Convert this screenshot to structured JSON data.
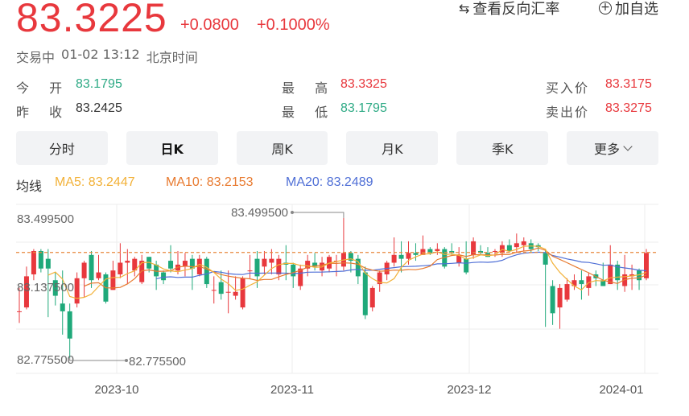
{
  "quote": {
    "price": "83.3225",
    "change": "+0.0800",
    "change_pct": "+0.1000%",
    "status": "交易中",
    "datetime": "01-02 13:12",
    "timezone": "北京时间"
  },
  "actions": {
    "reverse_label": "查看反向汇率",
    "watchlist_label": "加自选"
  },
  "stats": {
    "open_label": "今 开",
    "open": "83.1795",
    "high_label": "最 高",
    "high": "83.3325",
    "bid_label": "买入价",
    "bid": "83.3175",
    "prev_label": "昨 收",
    "prev": "83.2425",
    "low_label": "最 低",
    "low": "83.1795",
    "ask_label": "卖出价",
    "ask": "83.3275"
  },
  "tabs": [
    "分时",
    "日K",
    "周K",
    "月K",
    "季K",
    "更多"
  ],
  "active_tab": "日K",
  "ma": {
    "label": "均线",
    "ma5": "MA5: 83.2447",
    "ma10": "MA10: 83.2153",
    "ma20": "MA20: 83.2489"
  },
  "colors": {
    "up": "#e8383d",
    "down": "#1fa97a",
    "ma5": "#f2b138",
    "ma10": "#e87a2f",
    "ma20": "#4f6fd6"
  },
  "chart_data": {
    "type": "candlestick",
    "y_tick_labels": [
      "83.499500",
      "83.137500",
      "82.775500"
    ],
    "ylim": [
      82.7755,
      83.4995
    ],
    "x_tick_labels": [
      "2023-10",
      "2023-11",
      "2023-12",
      "2024-01"
    ],
    "max_annotation": "83.499500",
    "min_annotation": "82.775500",
    "current_price": 83.3225,
    "candles": [
      [
        83.02,
        83.02,
        83.14,
        82.96
      ],
      [
        83.04,
        83.2,
        83.25,
        83.03
      ],
      [
        83.21,
        83.33,
        83.34,
        83.18
      ],
      [
        83.33,
        83.24,
        83.34,
        83.22
      ],
      [
        83.29,
        83.24,
        83.34,
        82.99
      ],
      [
        83.18,
        83.1,
        83.22,
        83.05
      ],
      [
        83.06,
        83.02,
        83.23,
        82.9
      ],
      [
        83.02,
        82.88,
        83.06,
        82.78
      ],
      [
        83.06,
        83.19,
        83.22,
        83.04
      ],
      [
        83.19,
        83.27,
        83.28,
        83.09
      ],
      [
        83.31,
        83.18,
        83.33,
        83.14
      ],
      [
        83.19,
        83.22,
        83.31,
        83.18
      ],
      [
        83.21,
        83.07,
        83.22,
        83.06
      ],
      [
        83.13,
        83.23,
        83.28,
        83.13
      ],
      [
        83.21,
        83.27,
        83.37,
        83.19
      ],
      [
        83.27,
        83.28,
        83.34,
        83.16
      ],
      [
        83.23,
        83.29,
        83.3,
        83.2
      ],
      [
        83.17,
        83.28,
        83.31,
        83.16
      ],
      [
        83.3,
        83.24,
        83.3,
        83.22
      ],
      [
        83.26,
        83.2,
        83.28,
        83.13
      ],
      [
        83.22,
        83.18,
        83.23,
        83.16
      ],
      [
        83.28,
        83.24,
        83.36,
        83.22
      ],
      [
        83.23,
        83.26,
        83.33,
        83.21
      ],
      [
        83.25,
        83.28,
        83.32,
        83.2
      ],
      [
        83.29,
        83.24,
        83.31,
        83.13
      ],
      [
        83.21,
        83.29,
        83.31,
        83.2
      ],
      [
        83.29,
        83.16,
        83.3,
        83.14
      ],
      [
        83.13,
        83.13,
        83.2,
        83.06
      ],
      [
        83.17,
        83.11,
        83.23,
        83.08
      ],
      [
        83.12,
        83.12,
        83.23,
        83.01
      ],
      [
        83.1,
        83.12,
        83.2,
        83.08
      ],
      [
        83.04,
        83.19,
        83.2,
        83.03
      ],
      [
        83.23,
        83.23,
        83.31,
        83.19
      ],
      [
        83.29,
        83.2,
        83.33,
        83.14
      ],
      [
        83.25,
        83.29,
        83.33,
        83.21
      ],
      [
        83.27,
        83.29,
        83.34,
        83.21
      ],
      [
        83.21,
        83.29,
        83.31,
        83.18
      ],
      [
        83.27,
        83.26,
        83.36,
        83.18
      ],
      [
        83.26,
        83.2,
        83.27,
        83.14
      ],
      [
        83.15,
        83.24,
        83.26,
        83.13
      ],
      [
        83.24,
        83.28,
        83.31,
        83.2
      ],
      [
        83.27,
        83.25,
        83.32,
        83.23
      ],
      [
        83.23,
        83.27,
        83.3,
        83.2
      ],
      [
        83.24,
        83.3,
        83.31,
        83.22
      ],
      [
        83.28,
        83.28,
        83.31,
        83.2
      ],
      [
        83.25,
        83.32,
        83.5,
        83.23
      ],
      [
        83.32,
        83.28,
        83.33,
        83.22
      ],
      [
        83.29,
        83.2,
        83.31,
        83.16
      ],
      [
        83.22,
        83.0,
        83.25,
        82.98
      ],
      [
        83.04,
        83.14,
        83.15,
        83.02
      ],
      [
        83.16,
        83.22,
        83.23,
        83.12
      ],
      [
        83.21,
        83.27,
        83.28,
        83.18
      ],
      [
        83.27,
        83.31,
        83.4,
        83.25
      ],
      [
        83.31,
        83.29,
        83.38,
        83.22
      ],
      [
        83.29,
        83.32,
        83.38,
        83.26
      ],
      [
        83.32,
        83.31,
        83.37,
        83.28
      ],
      [
        83.31,
        83.34,
        83.41,
        83.31
      ],
      [
        83.34,
        83.32,
        83.35,
        83.31
      ],
      [
        83.33,
        83.34,
        83.37,
        83.31
      ],
      [
        83.34,
        83.25,
        83.35,
        83.24
      ],
      [
        83.33,
        83.32,
        83.37,
        83.31
      ],
      [
        83.27,
        83.31,
        83.35,
        83.25
      ],
      [
        83.29,
        83.22,
        83.38,
        83.21
      ],
      [
        83.31,
        83.38,
        83.4,
        83.29
      ],
      [
        83.33,
        83.32,
        83.36,
        83.31
      ],
      [
        83.32,
        83.3,
        83.35,
        83.3
      ],
      [
        83.33,
        83.33,
        83.34,
        83.3
      ],
      [
        83.32,
        83.36,
        83.38,
        83.3
      ],
      [
        83.36,
        83.33,
        83.39,
        83.32
      ],
      [
        83.35,
        83.37,
        83.42,
        83.32
      ],
      [
        83.36,
        83.38,
        83.4,
        83.33
      ],
      [
        83.37,
        83.34,
        83.39,
        83.32
      ],
      [
        83.36,
        83.35,
        83.37,
        83.33
      ],
      [
        83.32,
        83.26,
        83.34,
        82.94
      ],
      [
        83.15,
        83.01,
        83.18,
        82.95
      ],
      [
        83.04,
        83.14,
        83.16,
        82.93
      ],
      [
        83.08,
        83.16,
        83.19,
        83.07
      ],
      [
        83.15,
        83.18,
        83.21,
        83.13
      ],
      [
        83.18,
        83.16,
        83.23,
        83.08
      ],
      [
        83.14,
        83.2,
        83.22,
        83.1
      ],
      [
        83.21,
        83.19,
        83.23,
        83.15
      ],
      [
        83.18,
        83.15,
        83.27,
        83.15
      ],
      [
        83.16,
        83.26,
        83.36,
        83.16
      ],
      [
        83.26,
        83.18,
        83.28,
        83.13
      ],
      [
        83.15,
        83.21,
        83.31,
        83.12
      ],
      [
        83.2,
        83.21,
        83.26,
        83.13
      ],
      [
        83.23,
        83.18,
        83.24,
        83.13
      ],
      [
        83.19,
        83.32,
        83.34,
        83.18
      ]
    ]
  }
}
